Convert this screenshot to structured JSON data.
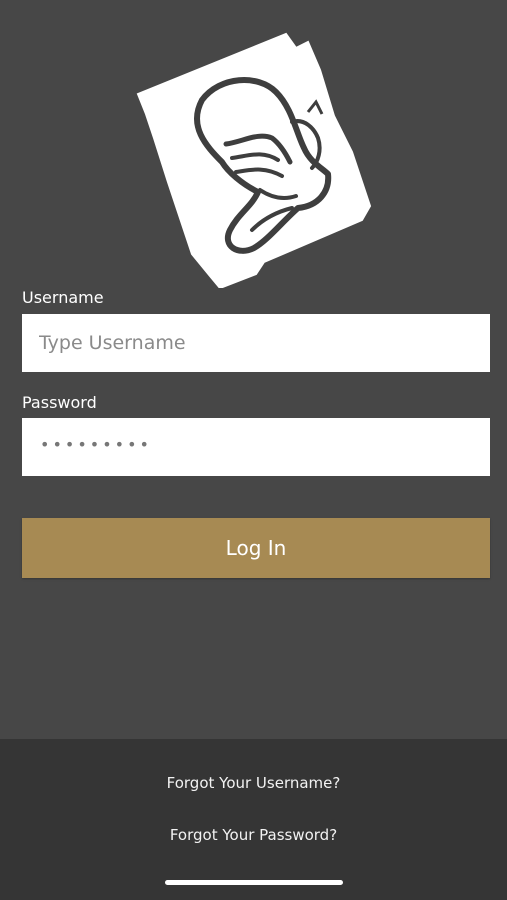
{
  "login": {
    "username_label": "Username",
    "username_placeholder": "Type Username",
    "password_label": "Password",
    "password_masked": "•••••••••",
    "login_button": "Log In"
  },
  "footer": {
    "forgot_username": "Forgot Your Username?",
    "forgot_password": "Forgot Your Password?"
  },
  "colors": {
    "background": "#474747",
    "footer_background": "#353535",
    "button": "#a78a53",
    "input_background": "#ffffff"
  },
  "icons": {
    "logo": "boot-logo-icon"
  }
}
